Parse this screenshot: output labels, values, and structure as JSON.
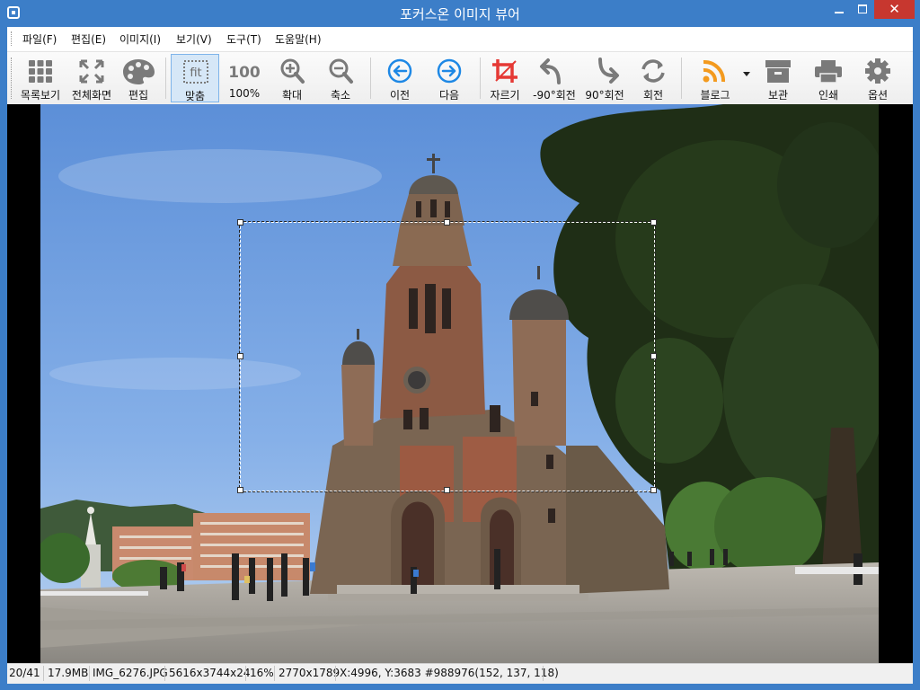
{
  "window": {
    "title": "포커스온 이미지 뷰어",
    "close_glyph": "✕"
  },
  "menu": {
    "items": [
      {
        "label": "파일(F)"
      },
      {
        "label": "편집(E)"
      },
      {
        "label": "이미지(I)"
      },
      {
        "label": "보기(V)"
      },
      {
        "label": "도구(T)"
      },
      {
        "label": "도움말(H)"
      }
    ]
  },
  "toolbar": {
    "items": [
      {
        "label": "목록보기",
        "icon": "grid-icon"
      },
      {
        "label": "전체화면",
        "icon": "fullscreen-icon"
      },
      {
        "label": "편집",
        "icon": "palette-icon"
      },
      {
        "label": "맞춤",
        "icon": "fit-icon",
        "icon_text": "fit",
        "active": true
      },
      {
        "label": "100%",
        "icon": "actual-size-icon",
        "icon_text": "100"
      },
      {
        "label": "확대",
        "icon": "zoom-in-icon"
      },
      {
        "label": "축소",
        "icon": "zoom-out-icon"
      },
      {
        "label": "이전",
        "icon": "arrow-left-icon"
      },
      {
        "label": "다음",
        "icon": "arrow-right-icon"
      },
      {
        "label": "자르기",
        "icon": "crop-icon"
      },
      {
        "label": "-90°회전",
        "icon": "rotate-left-icon"
      },
      {
        "label": "90°회전",
        "icon": "rotate-right-icon"
      },
      {
        "label": "회전",
        "icon": "rotate-icon"
      },
      {
        "label": "블로그",
        "icon": "rss-icon"
      },
      {
        "label": "보관",
        "icon": "archive-icon"
      },
      {
        "label": "인쇄",
        "icon": "printer-icon"
      },
      {
        "label": "옵션",
        "icon": "gear-icon"
      }
    ],
    "accent": "#1e88e5",
    "crop_color": "#e53935",
    "rss_color": "#f39a1e"
  },
  "image": {
    "subject": "brick-cathedral-photo"
  },
  "status": {
    "index": "20/41",
    "filesize": "17.9MB",
    "filename": "IMG_6276.JPG",
    "dimensions": "5616x3744x24",
    "zoom": "16%",
    "selection": "2770x1789",
    "cursor": "X:4996, Y:3683 #988976(152, 137, 118)"
  }
}
